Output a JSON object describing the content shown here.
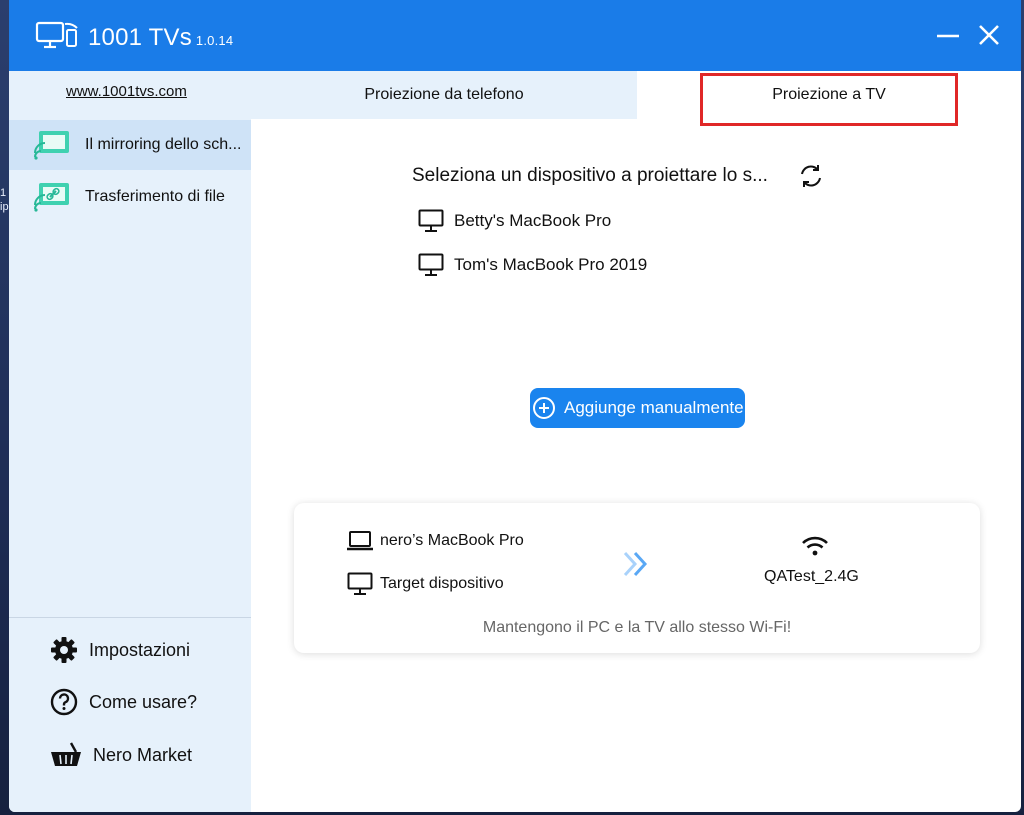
{
  "app": {
    "name": "1001 TVs",
    "version": "1.0.14",
    "colors": {
      "titlebar": "#1a7ce8",
      "sidebar": "#e6f1fb",
      "accent": "#1a84ee",
      "highlight": "#e02828"
    }
  },
  "window_controls": {
    "minimize_icon": "minimize-icon",
    "close_icon": "close-icon"
  },
  "desktop": {
    "edge_text": "1 ip"
  },
  "sidebar": {
    "website": "www.1001tvs.com",
    "items": [
      {
        "label": "Il mirroring dello sch...",
        "icon": "screen-mirror-icon",
        "active": true
      },
      {
        "label": "Trasferimento di file",
        "icon": "file-transfer-icon",
        "active": false
      }
    ],
    "bottom": [
      {
        "label": "Impostazioni",
        "icon": "gear-icon"
      },
      {
        "label": "Come usare?",
        "icon": "help-icon"
      },
      {
        "label": "Nero Market",
        "icon": "basket-icon"
      }
    ]
  },
  "tabs": [
    {
      "label": "Proiezione da telefono",
      "selected": false
    },
    {
      "label": "Proiezione a TV",
      "selected": true
    }
  ],
  "main": {
    "heading": "Seleziona un dispositivo a proiettare lo s...",
    "devices": [
      {
        "name": "Betty's MacBook Pro",
        "icon": "monitor-icon"
      },
      {
        "name": "Tom's MacBook Pro 2019",
        "icon": "monitor-icon"
      }
    ],
    "add_button": "Aggiunge manualmente"
  },
  "connection_card": {
    "source": "nero’s MacBook Pro",
    "target": "Target dispositivo",
    "wifi": "QATest_2.4G",
    "note": "Mantengono il PC e la TV allo stesso Wi-Fi!"
  }
}
